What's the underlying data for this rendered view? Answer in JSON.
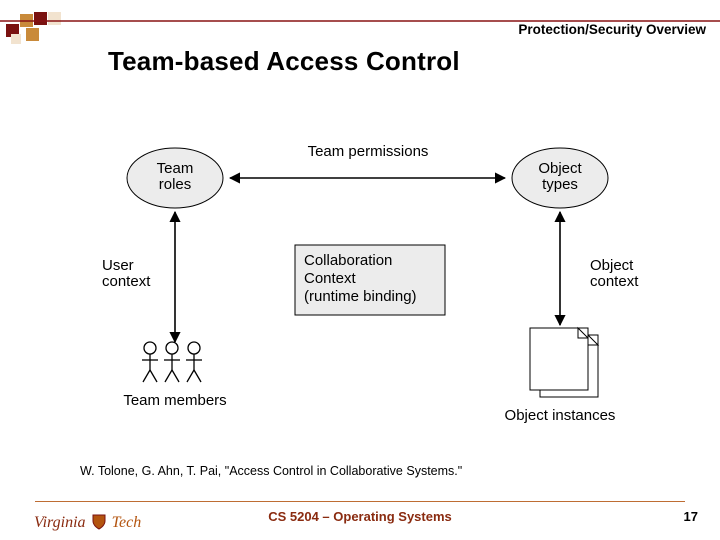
{
  "header": {
    "section": "Protection/Security Overview",
    "title": "Team-based Access Control"
  },
  "diagram": {
    "team_roles": "Team\nroles",
    "object_types": "Object\ntypes",
    "team_permissions": "Team permissions",
    "collab_context": "Collaboration\nContext\n(runtime binding)",
    "user_context": "User\ncontext",
    "object_context": "Object\ncontext",
    "team_members": "Team members",
    "object_instances": "Object instances"
  },
  "citation": "W. Tolone, G. Ahn, T. Pai, \"Access Control in Collaborative Systems.\"",
  "footer": {
    "course": "CS 5204 – Operating Systems",
    "page": "17",
    "logo_left": "Virginia",
    "logo_right": "Tech"
  }
}
